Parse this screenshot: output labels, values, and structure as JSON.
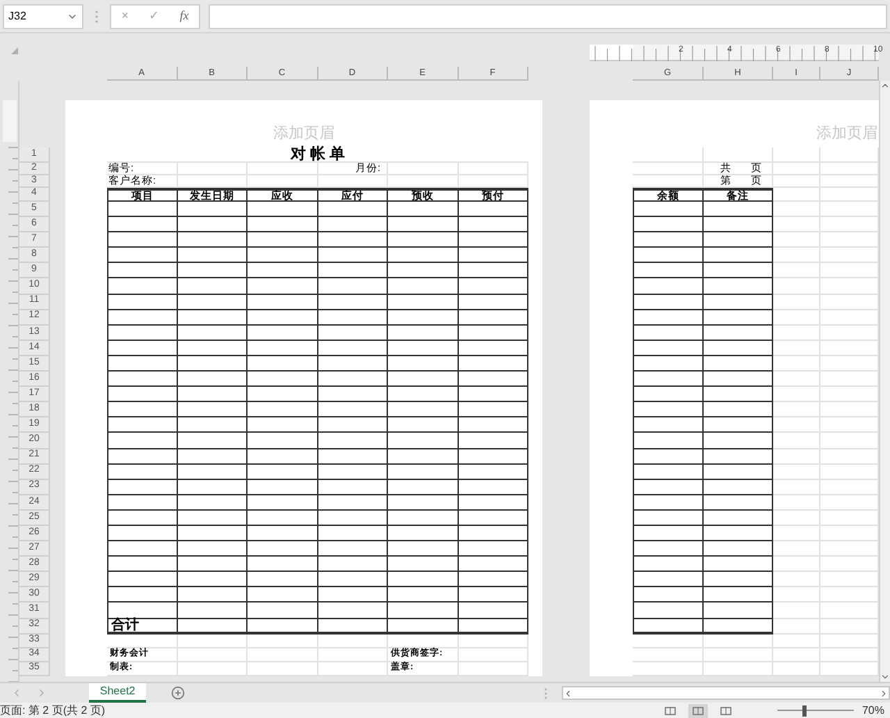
{
  "formula_bar": {
    "name_box": "J32",
    "cancel": "×",
    "enter": "✓",
    "function": "fx"
  },
  "ruler_numbers": [
    "2",
    "4",
    "6",
    "8",
    "10"
  ],
  "columns_page1": [
    "A",
    "B",
    "C",
    "D",
    "E",
    "F"
  ],
  "columns_page2": [
    "G",
    "H",
    "I",
    "J"
  ],
  "pages": [
    {
      "header_placeholder": "添加页眉"
    },
    {
      "header_placeholder": "添加页眉"
    }
  ],
  "rows": [
    {
      "number": "1",
      "kind": "title",
      "title": "对 帐 单"
    },
    {
      "number": "2",
      "kind": "info",
      "label": "编号:",
      "label2": "月份:",
      "count_a": "共",
      "count_b": "页"
    },
    {
      "number": "3",
      "kind": "info",
      "label": "客户名称:",
      "count_a": "第",
      "count_b": "页"
    },
    {
      "number": "4",
      "kind": "header",
      "page1_headers": [
        "项目",
        "发生日期",
        "应收",
        "应付",
        "预收",
        "预付"
      ],
      "page2_headers": [
        "余额",
        "备注"
      ]
    },
    {
      "number": "5",
      "kind": "body"
    },
    {
      "number": "6",
      "kind": "body"
    },
    {
      "number": "7",
      "kind": "body"
    },
    {
      "number": "8",
      "kind": "body"
    },
    {
      "number": "9",
      "kind": "body"
    },
    {
      "number": "10",
      "kind": "body"
    },
    {
      "number": "11",
      "kind": "body"
    },
    {
      "number": "12",
      "kind": "body"
    },
    {
      "number": "13",
      "kind": "body"
    },
    {
      "number": "14",
      "kind": "body"
    },
    {
      "number": "15",
      "kind": "body"
    },
    {
      "number": "16",
      "kind": "body"
    },
    {
      "number": "17",
      "kind": "body"
    },
    {
      "number": "18",
      "kind": "body"
    },
    {
      "number": "19",
      "kind": "body"
    },
    {
      "number": "20",
      "kind": "body"
    },
    {
      "number": "21",
      "kind": "body"
    },
    {
      "number": "22",
      "kind": "body"
    },
    {
      "number": "23",
      "kind": "body"
    },
    {
      "number": "24",
      "kind": "body"
    },
    {
      "number": "25",
      "kind": "body"
    },
    {
      "number": "26",
      "kind": "body"
    },
    {
      "number": "27",
      "kind": "body"
    },
    {
      "number": "28",
      "kind": "body"
    },
    {
      "number": "29",
      "kind": "body"
    },
    {
      "number": "30",
      "kind": "body"
    },
    {
      "number": "31",
      "kind": "body"
    },
    {
      "number": "32",
      "kind": "total",
      "label": "合计"
    },
    {
      "number": "33",
      "kind": "spacer"
    },
    {
      "number": "34",
      "kind": "footer",
      "label": "财务会计",
      "label2": "供货商签字:"
    },
    {
      "number": "35",
      "kind": "footer",
      "label": "制表:",
      "label2": "盖章:"
    }
  ],
  "sheet_tabs": [
    {
      "label": "Sheet2",
      "selected": true
    }
  ],
  "status_bar": {
    "text": "页面: 第 2 页(共 2 页)",
    "views": [
      {
        "selected": false
      },
      {
        "selected": true
      },
      {
        "selected": false
      }
    ],
    "zoom_slider": {
      "level": 0.35
    },
    "zoom": "70%"
  }
}
